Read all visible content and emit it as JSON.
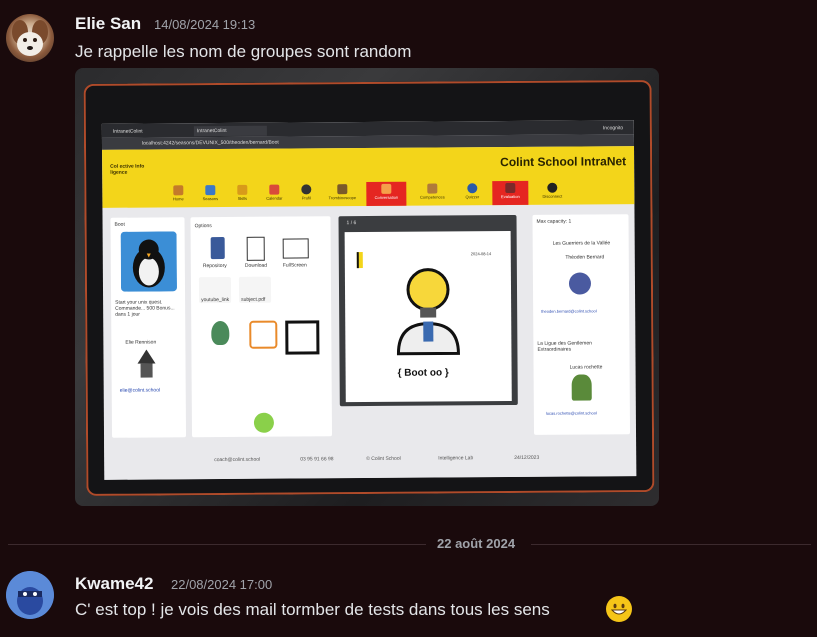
{
  "messages": [
    {
      "author": "Elie San",
      "timestamp": "14/08/2024 19:13",
      "text": "Je rappelle les nom de groupes sont random",
      "avatar": "dog-avatar",
      "attachment": {
        "type": "photo",
        "screen": {
          "tabs": [
            "IntranetColint",
            "IntranetColint"
          ],
          "url": "localhost:4242/seasons/DEVUNIX_500/theoden/bernard/Boot",
          "incognito": "Incognito",
          "brand": "Colint School IntraNet",
          "collective": "Col ective Info ligence",
          "nav": [
            "Home",
            "Seasons",
            "Skills",
            "Calendar",
            "Profil",
            "Trombinoscope",
            "Conversation",
            "Competences",
            "Quizzer",
            "Evaluation",
            "Disconnect"
          ],
          "left_panel": {
            "title": "Boot",
            "desc": "Start your unix quest. Commande... 500 Bonus... dans 1 jour",
            "person": "Elie Rennison",
            "email": "elie@colint.school"
          },
          "options": {
            "title": "Options",
            "items": [
              "Repository",
              "Download",
              "FullScreen"
            ],
            "files": [
              "youtube_link",
              "subject.pdf"
            ]
          },
          "pdf": {
            "page": "1 / 6",
            "caption": "{ Boot oo }",
            "date": "2024-08-14"
          },
          "right_panel": {
            "capacity": "Max capacity: 1",
            "group1": "Les Guerriers de la Vallée",
            "member1": "Théoden Bernard",
            "email1": "theoden.bernard@colint.school",
            "group2": "La Ligue des Gentlemen Extraordinaires",
            "member2": "Lucas rochette",
            "email2": "lucas.rochette@colint.school"
          },
          "footer": [
            "coach@colint.school",
            "03 95 91 66 98",
            "© Colint School",
            "Intelligence Lab",
            "24/12/2023"
          ]
        }
      }
    },
    {
      "author": "Kwame42",
      "timestamp": "22/08/2024 17:00",
      "text": "C' est top ! je vois des mail tormber de tests dans tous les sens",
      "avatar": "ninja-avatar",
      "emoji": "grinning-face"
    }
  ],
  "date_separator": "22 août 2024",
  "colors": {
    "background": "#1a0a0c",
    "intranet_yellow": "#f3d51a",
    "intranet_red": "#e52621"
  }
}
